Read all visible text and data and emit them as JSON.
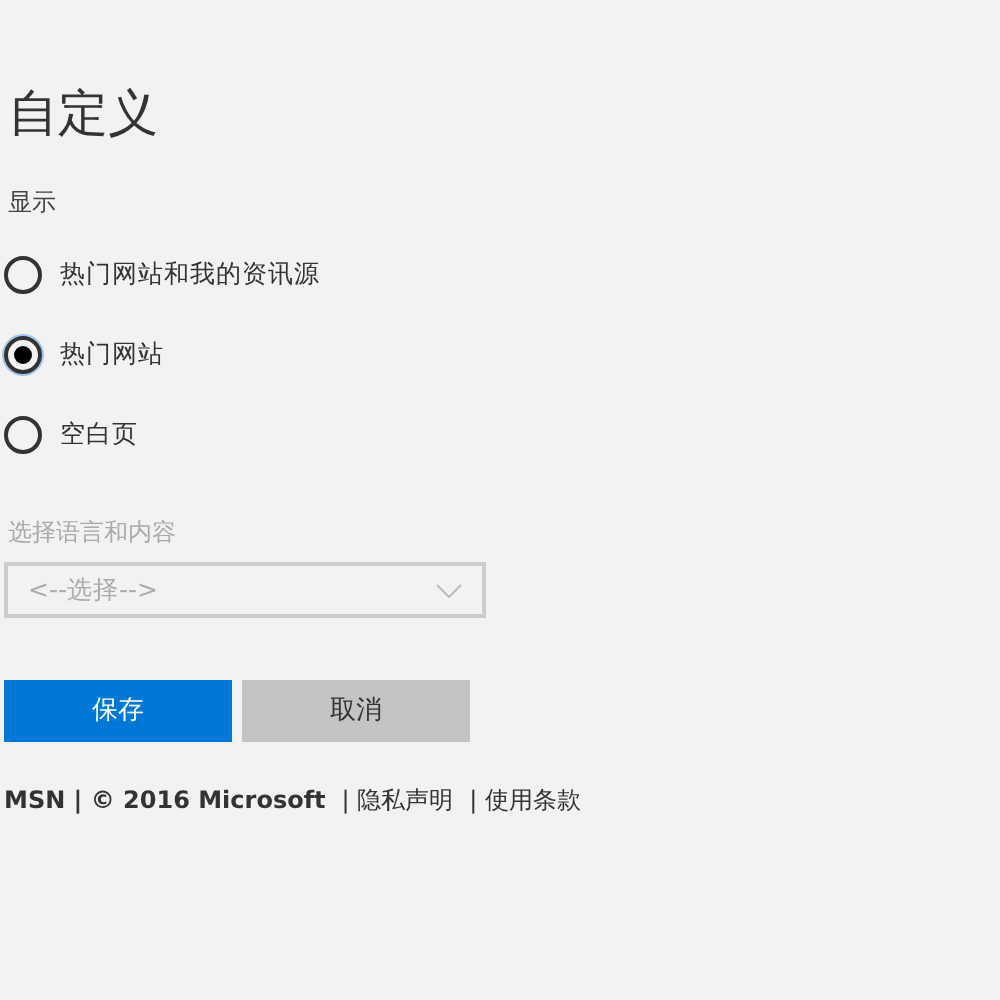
{
  "title": "自定义",
  "display": {
    "label": "显示",
    "options": [
      {
        "label": "热门网站和我的资讯源",
        "selected": false
      },
      {
        "label": "热门网站",
        "selected": true
      },
      {
        "label": "空白页",
        "selected": false
      }
    ]
  },
  "language": {
    "label": "选择语言和内容",
    "value": "<--选择-->",
    "disabled": true
  },
  "buttons": [
    {
      "label": "保存",
      "kind": "primary"
    },
    {
      "label": "取消",
      "kind": "secondary"
    }
  ],
  "footer": {
    "copyright": "MSN | © 2016 Microsoft",
    "links": [
      "| 隐私声明",
      "| 使用条款"
    ]
  }
}
